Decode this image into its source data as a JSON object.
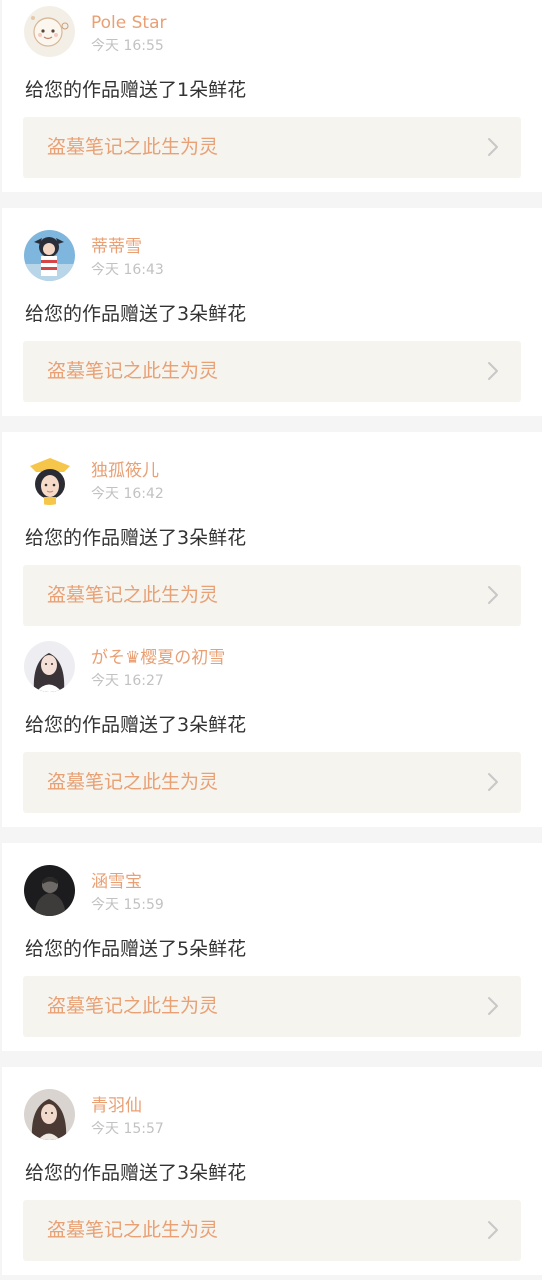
{
  "colors": {
    "accent": "#e8a074",
    "timestamp": "#c2c2c2",
    "message_text": "#333333",
    "link_card_bg": "#f5f4ee",
    "page_bg": "#f5f5f5",
    "chevron": "#c8c8c8"
  },
  "icons": {
    "chevron": "chevron-right-icon"
  },
  "notifications": [
    {
      "username": "Pole Star",
      "time": "今天 16:55",
      "message": "给您的作品赠送了1朵鲜花",
      "work_title": "盗墓笔记之此生为灵",
      "avatar": "cartoon-sticker-avatar"
    },
    {
      "username": "蒂蒂雪",
      "time": "今天 16:43",
      "message": "给您的作品赠送了3朵鲜花",
      "work_title": "盗墓笔记之此生为灵",
      "avatar": "anime-figure-avatar"
    },
    {
      "username": "独孤筱儿",
      "time": "今天 16:42",
      "message": "给您的作品赠送了3朵鲜花",
      "work_title": "盗墓笔记之此生为灵",
      "avatar": "cartoon-girl-avatar"
    },
    {
      "username": "がそ♛樱夏の初雪",
      "time": "今天 16:27",
      "message": "给您的作品赠送了3朵鲜花",
      "work_title": "盗墓笔记之此生为灵",
      "avatar": "photo-woman-avatar"
    },
    {
      "username": "涵雪宝",
      "time": "今天 15:59",
      "message": "给您的作品赠送了5朵鲜花",
      "work_title": "盗墓笔记之此生为灵",
      "avatar": "photo-man-dark-avatar"
    },
    {
      "username": "青羽仙",
      "time": "今天 15:57",
      "message": "给您的作品赠送了3朵鲜花",
      "work_title": "盗墓笔记之此生为灵",
      "avatar": "photo-woman-2-avatar"
    }
  ]
}
